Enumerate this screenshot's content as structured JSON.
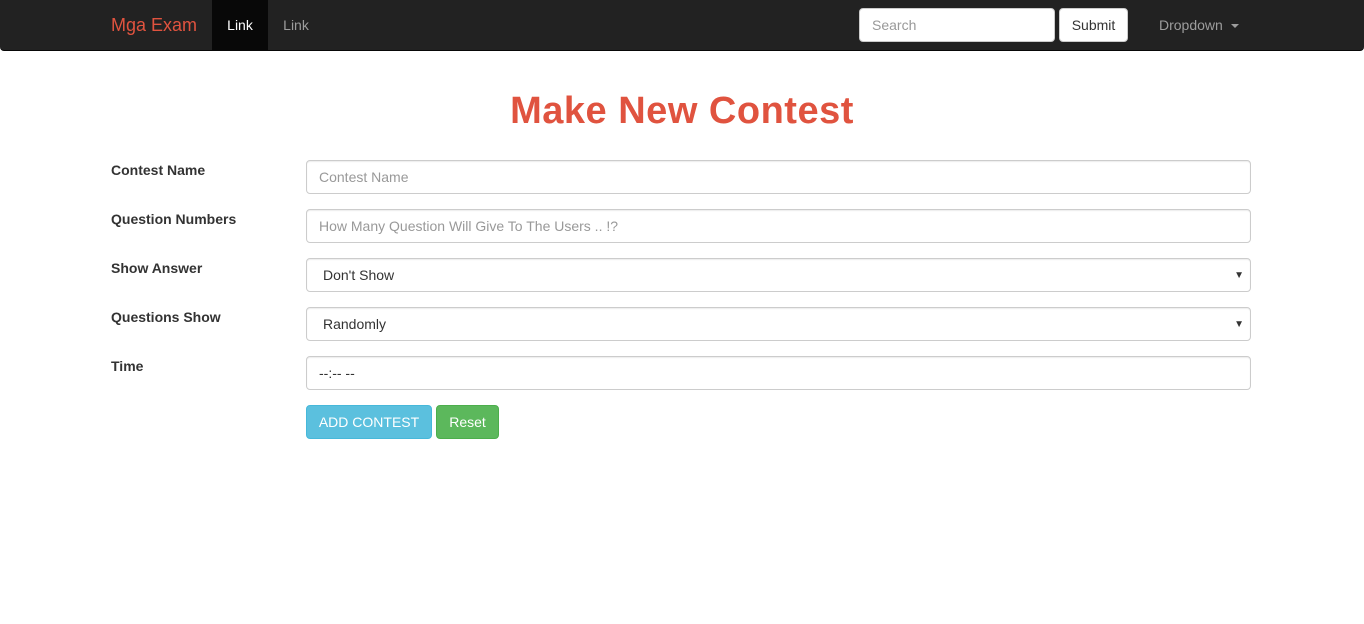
{
  "navbar": {
    "brand": "Mga Exam",
    "links": [
      "Link",
      "Link"
    ],
    "search_placeholder": "Search",
    "submit_label": "Submit",
    "dropdown_label": "Dropdown"
  },
  "page": {
    "title": "Make New Contest"
  },
  "form": {
    "contest_name": {
      "label": "Contest Name",
      "placeholder": "Contest Name",
      "value": ""
    },
    "question_numbers": {
      "label": "Question Numbers",
      "placeholder": "How Many Question Will Give To The Users .. !?",
      "value": ""
    },
    "show_answer": {
      "label": "Show Answer",
      "selected": "Don't Show"
    },
    "questions_show": {
      "label": "Questions Show",
      "selected": "Randomly"
    },
    "time": {
      "label": "Time",
      "value": "--:-- --"
    },
    "add_button": "ADD CONTEST",
    "reset_button": "Reset"
  },
  "colors": {
    "accent": "#e0533f",
    "navbar_bg": "#222222",
    "btn_info": "#5bc0de",
    "btn_success": "#5cb85c"
  },
  "icons": {
    "dropdown_caret": "caret-down-icon",
    "select_arrow": "chevron-down-icon"
  }
}
